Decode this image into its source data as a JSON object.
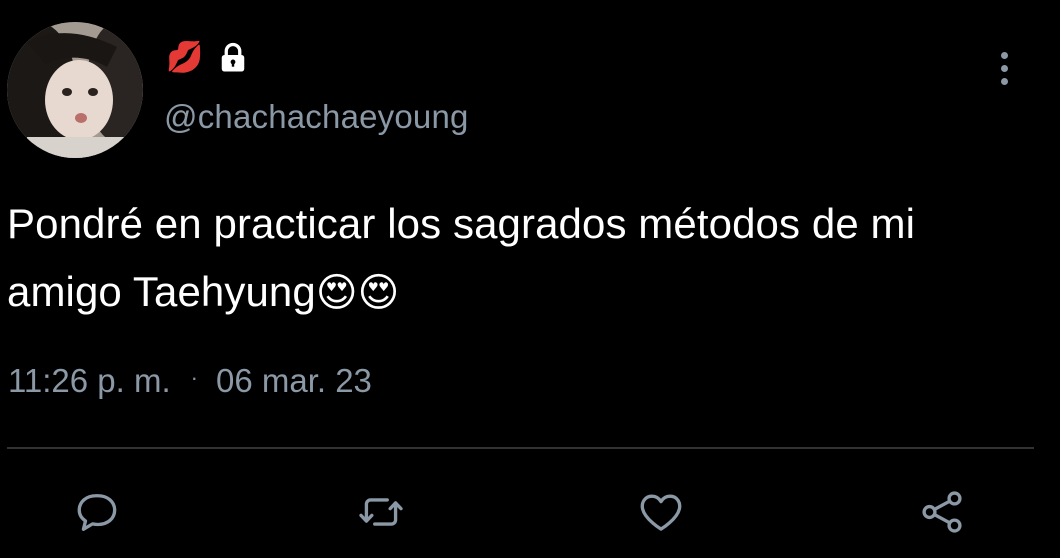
{
  "tweet": {
    "display_name_emoji": "💋",
    "handle": "@chachachaeyoung",
    "text_line1": "Pondré en practicar los sagrados métodos de mi",
    "text_line2": "amigo Taehyung",
    "text_emojis": "😍😍",
    "time": "11:26 p. m.",
    "separator": "·",
    "date": "06 mar. 23"
  },
  "icons": {
    "lock": "lock-icon",
    "more": "more-vertical-icon",
    "reply": "reply-icon",
    "retweet": "retweet-icon",
    "like": "heart-icon",
    "share": "share-icon"
  },
  "colors": {
    "background": "#000000",
    "text": "#ffffff",
    "secondary": "#8b98a5",
    "divider": "#2f3336"
  }
}
